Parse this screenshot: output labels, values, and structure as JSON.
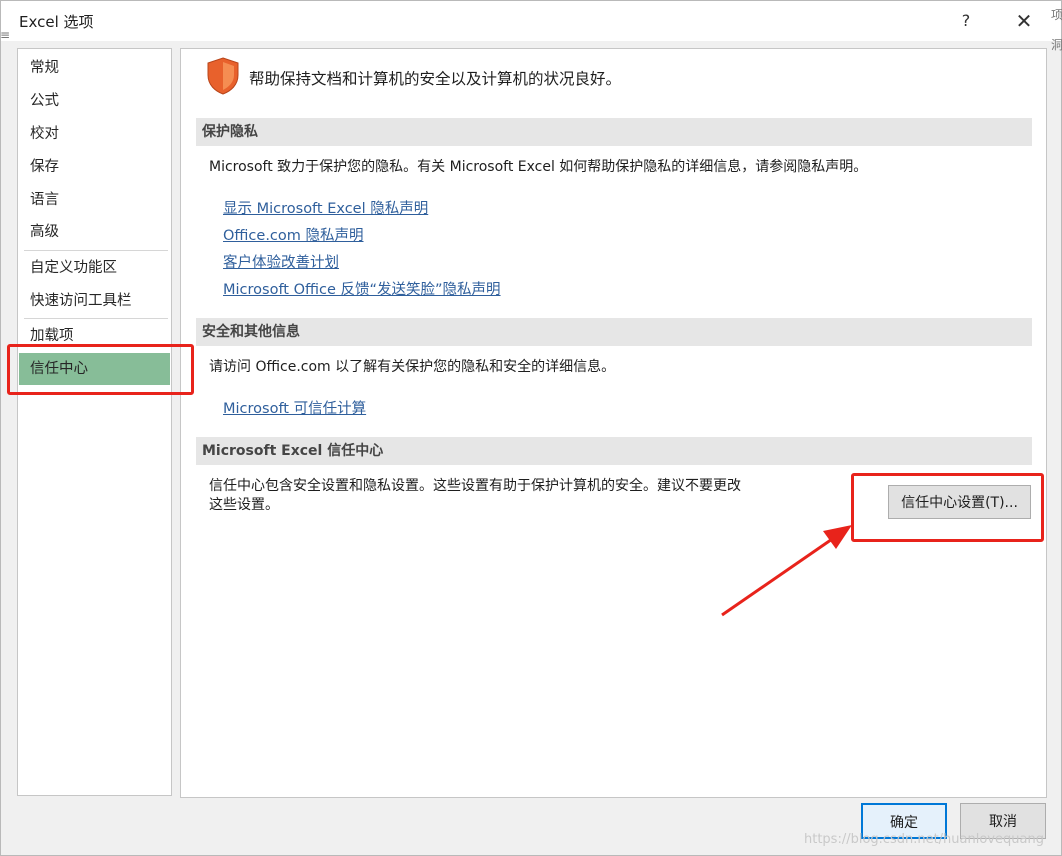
{
  "window": {
    "title": "Excel 选项",
    "help_label": "?",
    "close_label": "✕"
  },
  "sidebar": {
    "items": [
      {
        "label": "常规"
      },
      {
        "label": "公式"
      },
      {
        "label": "校对"
      },
      {
        "label": "保存"
      },
      {
        "label": "语言"
      },
      {
        "label": "高级"
      },
      {
        "label": "自定义功能区"
      },
      {
        "label": "快速访问工具栏"
      },
      {
        "label": "加载项"
      },
      {
        "label": "信任中心",
        "selected": true
      }
    ]
  },
  "header": {
    "text": "帮助保持文档和计算机的安全以及计算机的状况良好。",
    "icon": "shield-icon"
  },
  "privacy": {
    "title": "保护隐私",
    "text": "Microsoft 致力于保护您的隐私。有关 Microsoft Excel 如何帮助保护隐私的详细信息，请参阅隐私声明。",
    "links": [
      "显示 Microsoft Excel 隐私声明",
      "Office.com 隐私声明",
      "客户体验改善计划",
      "Microsoft Office 反馈“发送笑脸”隐私声明"
    ]
  },
  "security": {
    "title": "安全和其他信息",
    "text": "请访问 Office.com 以了解有关保护您的隐私和安全的详细信息。",
    "link": "Microsoft 可信任计算"
  },
  "trust_center": {
    "title": "Microsoft Excel 信任中心",
    "text_line1": "信任中心包含安全设置和隐私设置。这些设置有助于保护计算机的安全。建议不要更改",
    "text_line2": "这些设置。",
    "button": "信任中心设置(T)..."
  },
  "footer": {
    "ok": "确定",
    "cancel": "取消"
  },
  "edge_glyphs": {
    "top": "项",
    "left": "≡",
    "mid": "洞"
  },
  "watermark": "https://blog.csdn.net/huanlovequang",
  "colors": {
    "accent_selected": "#87bd98",
    "link": "#2f5f9c",
    "annotation_red": "#e8231b",
    "shield": "#e8612c"
  }
}
